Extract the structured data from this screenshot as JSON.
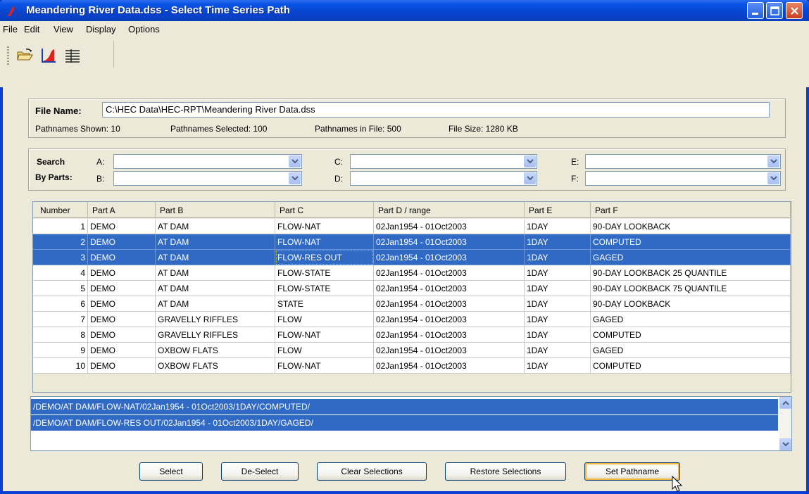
{
  "window": {
    "title": "Meandering River Data.dss - Select Time Series Path"
  },
  "menu": [
    "File",
    "Edit",
    "View",
    "Display",
    "Options"
  ],
  "toolbar": {
    "icons": [
      "open-folder-icon",
      "plot-icon",
      "tabulate-icon"
    ]
  },
  "file_info": {
    "label": "File Name:",
    "path": "C:\\HEC Data\\HEC-RPT\\Meandering River Data.dss",
    "shown": "Pathnames Shown:  10",
    "selected": "Pathnames Selected: 100",
    "in_file": "Pathnames in File:  500",
    "size": "File Size:  1280  KB"
  },
  "search": {
    "label1": "Search",
    "label2": "By Parts:",
    "parts": [
      "A:",
      "B:",
      "C:",
      "D:",
      "E:",
      "F:"
    ]
  },
  "table": {
    "headers": [
      "Number",
      "Part A",
      "Part B",
      "Part C",
      "Part D / range",
      "Part E",
      "Part F"
    ],
    "rows": [
      {
        "n": "1",
        "a": "DEMO",
        "b": "AT DAM",
        "c": "FLOW-NAT",
        "d": "02Jan1954 - 01Oct2003",
        "e": "1DAY",
        "f": "90-DAY LOOKBACK",
        "selected": false
      },
      {
        "n": "2",
        "a": "DEMO",
        "b": "AT DAM",
        "c": "FLOW-NAT",
        "d": "02Jan1954 - 01Oct2003",
        "e": "1DAY",
        "f": "COMPUTED",
        "selected": true
      },
      {
        "n": "3",
        "a": "DEMO",
        "b": "AT DAM",
        "c": "FLOW-RES OUT",
        "d": "02Jan1954 - 01Oct2003",
        "e": "1DAY",
        "f": "GAGED",
        "selected": true
      },
      {
        "n": "4",
        "a": "DEMO",
        "b": "AT DAM",
        "c": "FLOW-STATE",
        "d": "02Jan1954 - 01Oct2003",
        "e": "1DAY",
        "f": "90-DAY LOOKBACK 25 QUANTILE",
        "selected": false
      },
      {
        "n": "5",
        "a": "DEMO",
        "b": "AT DAM",
        "c": "FLOW-STATE",
        "d": "02Jan1954 - 01Oct2003",
        "e": "1DAY",
        "f": "90-DAY LOOKBACK 75 QUANTILE",
        "selected": false
      },
      {
        "n": "6",
        "a": "DEMO",
        "b": "AT DAM",
        "c": "STATE",
        "d": "02Jan1954 - 01Oct2003",
        "e": "1DAY",
        "f": "90-DAY LOOKBACK",
        "selected": false
      },
      {
        "n": "7",
        "a": "DEMO",
        "b": "GRAVELLY RIFFLES",
        "c": "FLOW",
        "d": "02Jan1954 - 01Oct2003",
        "e": "1DAY",
        "f": "GAGED",
        "selected": false
      },
      {
        "n": "8",
        "a": "DEMO",
        "b": "GRAVELLY RIFFLES",
        "c": "FLOW-NAT",
        "d": "02Jan1954 - 01Oct2003",
        "e": "1DAY",
        "f": "COMPUTED",
        "selected": false
      },
      {
        "n": "9",
        "a": "DEMO",
        "b": "OXBOW FLATS",
        "c": "FLOW",
        "d": "02Jan1954 - 01Oct2003",
        "e": "1DAY",
        "f": "GAGED",
        "selected": false
      },
      {
        "n": "10",
        "a": "DEMO",
        "b": "OXBOW FLATS",
        "c": "FLOW-NAT",
        "d": "02Jan1954 - 01Oct2003",
        "e": "1DAY",
        "f": "COMPUTED",
        "selected": false
      }
    ]
  },
  "selected_paths": [
    "/DEMO/AT DAM/FLOW-NAT/02Jan1954 - 01Oct2003/1DAY/COMPUTED/",
    "/DEMO/AT DAM/FLOW-RES OUT/02Jan1954 - 01Oct2003/1DAY/GAGED/"
  ],
  "buttons": {
    "select": "Select",
    "deselect": "De-Select",
    "clear": "Clear Selections",
    "restore": "Restore Selections",
    "set": "Set Pathname"
  },
  "colors": {
    "title_bar": "#0a55e6",
    "selection": "#316ac5",
    "window_bg": "#ece9d8"
  }
}
